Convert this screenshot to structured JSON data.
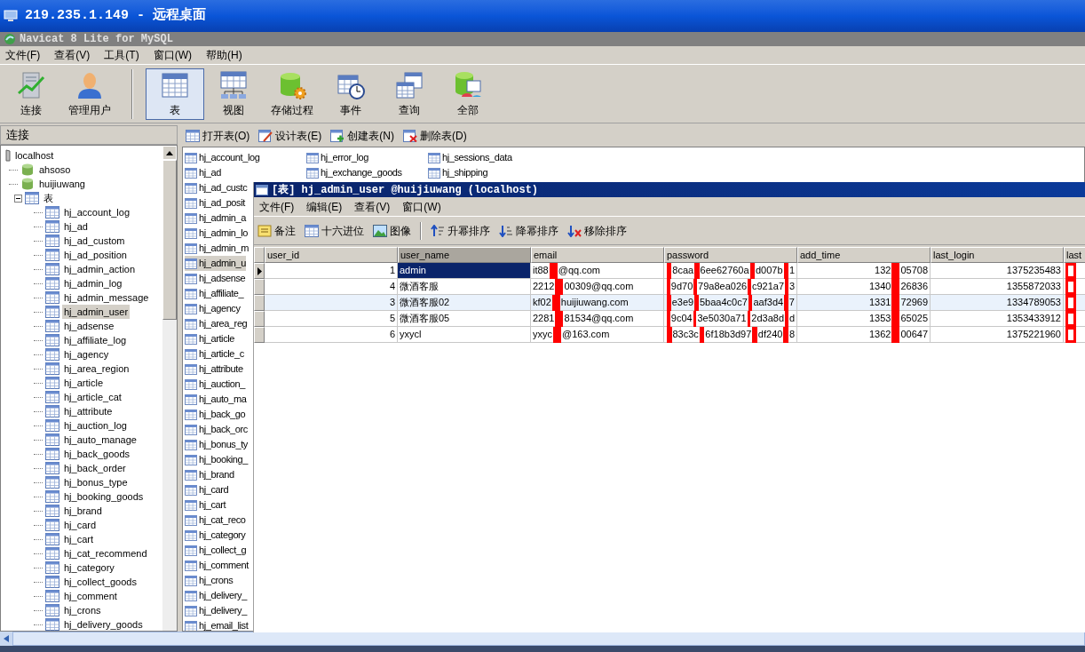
{
  "remote_window": {
    "title": "219.235.1.149 - 远程桌面"
  },
  "app_window": {
    "title": "Navicat 8 Lite for MySQL"
  },
  "menu": [
    "文件(F)",
    "查看(V)",
    "工具(T)",
    "窗口(W)",
    "帮助(H)"
  ],
  "toolbar": [
    {
      "kind": "connection",
      "label": "连接",
      "selected": false
    },
    {
      "kind": "user",
      "label": "管理用户",
      "selected": false
    },
    {
      "kind": "separator"
    },
    {
      "kind": "table",
      "label": "表",
      "selected": true
    },
    {
      "kind": "view",
      "label": "视图",
      "selected": false
    },
    {
      "kind": "procedure",
      "label": "存储过程",
      "selected": false
    },
    {
      "kind": "event",
      "label": "事件",
      "selected": false
    },
    {
      "kind": "query",
      "label": "查询",
      "selected": false
    },
    {
      "kind": "all",
      "label": "全部",
      "selected": false
    }
  ],
  "sidebar": {
    "title": "连接",
    "tree": [
      {
        "kind": "server",
        "label": "localhost",
        "selected": false,
        "children": [
          {
            "kind": "database",
            "label": "ahsoso",
            "selected": false
          },
          {
            "kind": "database",
            "label": "huijiuwang",
            "selected": false,
            "children": [
              {
                "kind": "folder",
                "label": "表",
                "selected": false,
                "expanded": true,
                "children": [
                  {
                    "kind": "table",
                    "label": "hj_account_log",
                    "selected": false
                  },
                  {
                    "kind": "table",
                    "label": "hj_ad",
                    "selected": false
                  },
                  {
                    "kind": "table",
                    "label": "hj_ad_custom",
                    "selected": false
                  },
                  {
                    "kind": "table",
                    "label": "hj_ad_position",
                    "selected": false
                  },
                  {
                    "kind": "table",
                    "label": "hj_admin_action",
                    "selected": false
                  },
                  {
                    "kind": "table",
                    "label": "hj_admin_log",
                    "selected": false
                  },
                  {
                    "kind": "table",
                    "label": "hj_admin_message",
                    "selected": false
                  },
                  {
                    "kind": "table",
                    "label": "hj_admin_user",
                    "selected": true
                  },
                  {
                    "kind": "table",
                    "label": "hj_adsense",
                    "selected": false
                  },
                  {
                    "kind": "table",
                    "label": "hj_affiliate_log",
                    "selected": false
                  },
                  {
                    "kind": "table",
                    "label": "hj_agency",
                    "selected": false
                  },
                  {
                    "kind": "table",
                    "label": "hj_area_region",
                    "selected": false
                  },
                  {
                    "kind": "table",
                    "label": "hj_article",
                    "selected": false
                  },
                  {
                    "kind": "table",
                    "label": "hj_article_cat",
                    "selected": false
                  },
                  {
                    "kind": "table",
                    "label": "hj_attribute",
                    "selected": false
                  },
                  {
                    "kind": "table",
                    "label": "hj_auction_log",
                    "selected": false
                  },
                  {
                    "kind": "table",
                    "label": "hj_auto_manage",
                    "selected": false
                  },
                  {
                    "kind": "table",
                    "label": "hj_back_goods",
                    "selected": false
                  },
                  {
                    "kind": "table",
                    "label": "hj_back_order",
                    "selected": false
                  },
                  {
                    "kind": "table",
                    "label": "hj_bonus_type",
                    "selected": false
                  },
                  {
                    "kind": "table",
                    "label": "hj_booking_goods",
                    "selected": false
                  },
                  {
                    "kind": "table",
                    "label": "hj_brand",
                    "selected": false
                  },
                  {
                    "kind": "table",
                    "label": "hj_card",
                    "selected": false
                  },
                  {
                    "kind": "table",
                    "label": "hj_cart",
                    "selected": false
                  },
                  {
                    "kind": "table",
                    "label": "hj_cat_recommend",
                    "selected": false
                  },
                  {
                    "kind": "table",
                    "label": "hj_category",
                    "selected": false
                  },
                  {
                    "kind": "table",
                    "label": "hj_collect_goods",
                    "selected": false
                  },
                  {
                    "kind": "table",
                    "label": "hj_comment",
                    "selected": false
                  },
                  {
                    "kind": "table",
                    "label": "hj_crons",
                    "selected": false
                  },
                  {
                    "kind": "table",
                    "label": "hj_delivery_goods",
                    "selected": false
                  }
                ]
              }
            ]
          }
        ]
      }
    ]
  },
  "object_toolbar": [
    {
      "kind": "open",
      "label": "打开表(O)"
    },
    {
      "kind": "design",
      "label": "设计表(E)"
    },
    {
      "kind": "create",
      "label": "创建表(N)"
    },
    {
      "kind": "delete",
      "label": "删除表(D)"
    }
  ],
  "object_list": {
    "columns": [
      [
        {
          "label": "hj_account_log",
          "selected": false
        },
        {
          "label": "hj_ad",
          "selected": false
        },
        {
          "label": "hj_ad_custc",
          "selected": false
        },
        {
          "label": "hj_ad_posit",
          "selected": false
        },
        {
          "label": "hj_admin_a",
          "selected": false
        },
        {
          "label": "hj_admin_lo",
          "selected": false
        },
        {
          "label": "hj_admin_m",
          "selected": false
        },
        {
          "label": "hj_admin_u",
          "selected": true
        },
        {
          "label": "hj_adsense",
          "selected": false
        },
        {
          "label": "hj_affiliate_",
          "selected": false
        },
        {
          "label": "hj_agency",
          "selected": false
        },
        {
          "label": "hj_area_reg",
          "selected": false
        },
        {
          "label": "hj_article",
          "selected": false
        },
        {
          "label": "hj_article_c",
          "selected": false
        },
        {
          "label": "hj_attribute",
          "selected": false
        },
        {
          "label": "hj_auction_",
          "selected": false
        },
        {
          "label": "hj_auto_ma",
          "selected": false
        },
        {
          "label": "hj_back_go",
          "selected": false
        },
        {
          "label": "hj_back_orc",
          "selected": false
        },
        {
          "label": "hj_bonus_ty",
          "selected": false
        },
        {
          "label": "hj_booking_",
          "selected": false
        },
        {
          "label": "hj_brand",
          "selected": false
        },
        {
          "label": "hj_card",
          "selected": false
        },
        {
          "label": "hj_cart",
          "selected": false
        },
        {
          "label": "hj_cat_reco",
          "selected": false
        },
        {
          "label": "hj_category",
          "selected": false
        },
        {
          "label": "hj_collect_g",
          "selected": false
        },
        {
          "label": "hj_comment",
          "selected": false
        },
        {
          "label": "hj_crons",
          "selected": false
        },
        {
          "label": "hj_delivery_",
          "selected": false
        },
        {
          "label": "hj_delivery_",
          "selected": false
        },
        {
          "label": "hj_email_list",
          "selected": false
        }
      ],
      [
        {
          "label": "hj_error_log",
          "selected": false
        },
        {
          "label": "hj_exchange_goods",
          "selected": false
        }
      ],
      [
        {
          "label": "hj_sessions_data",
          "selected": false
        },
        {
          "label": "hj_shipping",
          "selected": false
        }
      ]
    ]
  },
  "table_window": {
    "title": "[表] hj_admin_user @huijiuwang (localhost)",
    "menu": [
      "文件(F)",
      "编辑(E)",
      "查看(V)",
      "窗口(W)"
    ],
    "toolbar": [
      {
        "kind": "memo",
        "label": "备注"
      },
      {
        "kind": "hex",
        "label": "十六进位"
      },
      {
        "kind": "image",
        "label": "图像"
      },
      {
        "kind": "separator"
      },
      {
        "kind": "sort_asc",
        "label": "升幂排序"
      },
      {
        "kind": "sort_desc",
        "label": "降幂排序"
      },
      {
        "kind": "sort_remove",
        "label": "移除排序"
      }
    ],
    "columns": [
      {
        "label": "user_id",
        "kind": "number",
        "selected": false
      },
      {
        "label": "user_name",
        "kind": "text",
        "selected": true
      },
      {
        "label": "email",
        "kind": "text",
        "selected": false
      },
      {
        "label": "password",
        "kind": "text",
        "selected": false
      },
      {
        "label": "add_time",
        "kind": "number",
        "selected": false
      },
      {
        "label": "last_login",
        "kind": "number",
        "selected": false
      },
      {
        "label": "last",
        "kind": "text",
        "selected": false
      }
    ],
    "rows": [
      {
        "selected": true,
        "hovered": false,
        "cells": [
          "1",
          "admin",
          [
            "it88",
            {
              "kind": "redaction"
            },
            "@qq.com"
          ],
          [
            {
              "kind": "redaction"
            },
            "8caa",
            {
              "kind": "redaction"
            },
            "6ee62760a",
            {
              "kind": "redaction"
            },
            "d007b",
            {
              "kind": "redaction"
            },
            "1"
          ],
          [
            "132",
            {
              "kind": "redaction"
            },
            "05708"
          ],
          "1375235483",
          [
            {
              "kind": "outline_redaction"
            }
          ]
        ]
      },
      {
        "selected": false,
        "hovered": false,
        "cells": [
          "4",
          "微酒客服",
          [
            "2212",
            {
              "kind": "redaction"
            },
            "00309@qq.com"
          ],
          [
            {
              "kind": "redaction"
            },
            "9d70",
            {
              "kind": "redaction"
            },
            "79a8ea026",
            {
              "kind": "redaction"
            },
            "c921a7",
            {
              "kind": "redaction"
            },
            "3"
          ],
          [
            "1340",
            {
              "kind": "redaction"
            },
            "26836"
          ],
          "1355872033",
          [
            {
              "kind": "outline_redaction"
            }
          ]
        ]
      },
      {
        "selected": false,
        "hovered": true,
        "cells": [
          "3",
          "微酒客服02",
          [
            "kf02",
            {
              "kind": "redaction"
            },
            "huijiuwang.com"
          ],
          [
            {
              "kind": "redaction"
            },
            "e3e9",
            {
              "kind": "redaction"
            },
            "5baa4c0c7",
            {
              "kind": "redaction"
            },
            "aaf3d4",
            {
              "kind": "redaction"
            },
            "7"
          ],
          [
            "1331",
            {
              "kind": "redaction"
            },
            "72969"
          ],
          "1334789053",
          [
            {
              "kind": "outline_redaction"
            }
          ]
        ]
      },
      {
        "selected": false,
        "hovered": false,
        "cells": [
          "5",
          "微酒客服05",
          [
            "2281",
            {
              "kind": "redaction"
            },
            "81534@qq.com"
          ],
          [
            {
              "kind": "redaction"
            },
            "9c04",
            {
              "kind": "redaction"
            },
            "3e5030a71",
            {
              "kind": "redaction"
            },
            "2d3a8d",
            {
              "kind": "redaction"
            },
            "d"
          ],
          [
            "1353",
            {
              "kind": "redaction"
            },
            "65025"
          ],
          "1353433912",
          [
            {
              "kind": "outline_redaction"
            }
          ]
        ]
      },
      {
        "selected": false,
        "hovered": false,
        "cells": [
          "6",
          "yxycl",
          [
            "yxyc",
            {
              "kind": "redaction"
            },
            "@163.com"
          ],
          [
            {
              "kind": "redaction"
            },
            "83c3c",
            {
              "kind": "redaction"
            },
            "6f18b3d97",
            {
              "kind": "redaction"
            },
            "df240",
            {
              "kind": "redaction"
            },
            "8"
          ],
          [
            "1362",
            {
              "kind": "redaction"
            },
            "00647"
          ],
          "1375221960",
          [
            {
              "kind": "outline_redaction"
            }
          ]
        ]
      }
    ]
  }
}
